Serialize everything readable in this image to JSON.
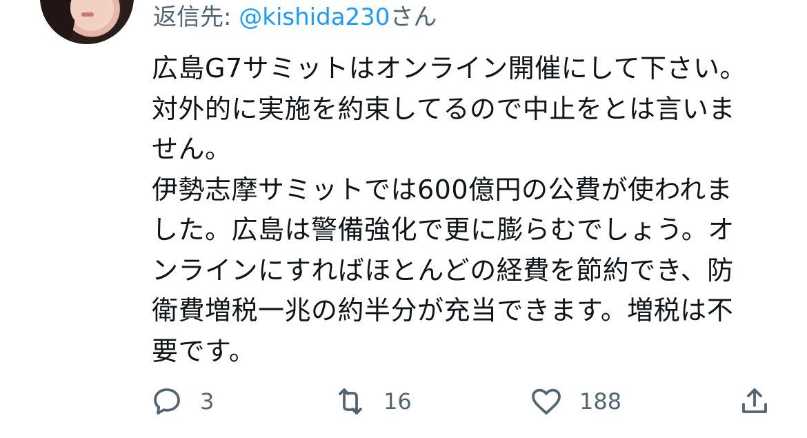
{
  "reply": {
    "prefix": "返信先: ",
    "mention": "@kishida230",
    "suffix": "さん"
  },
  "tweet": {
    "lines": [
      "広島G7サミットはオンライン開催にして下さい。",
      "対外的に実施を約束してるので中止をとは言いま",
      "せん。",
      "伊勢志摩サミットでは600億円の公費が使われま",
      "した。広島は警備強化で更に膨らむでしょう。オ",
      "ンラインにすればほとんどの経費を節約でき、防",
      "衛費増税一兆の約半分が充当できます。増税は不",
      "要です。"
    ]
  },
  "actions": {
    "reply": {
      "icon": "reply-bubble-icon",
      "count": "3"
    },
    "retweet": {
      "icon": "retweet-icon",
      "count": "16"
    },
    "like": {
      "icon": "heart-icon",
      "count": "188"
    },
    "share": {
      "icon": "share-icon"
    }
  },
  "colors": {
    "text": "#0f1419",
    "muted": "#536471",
    "link": "#1d9bf0"
  }
}
